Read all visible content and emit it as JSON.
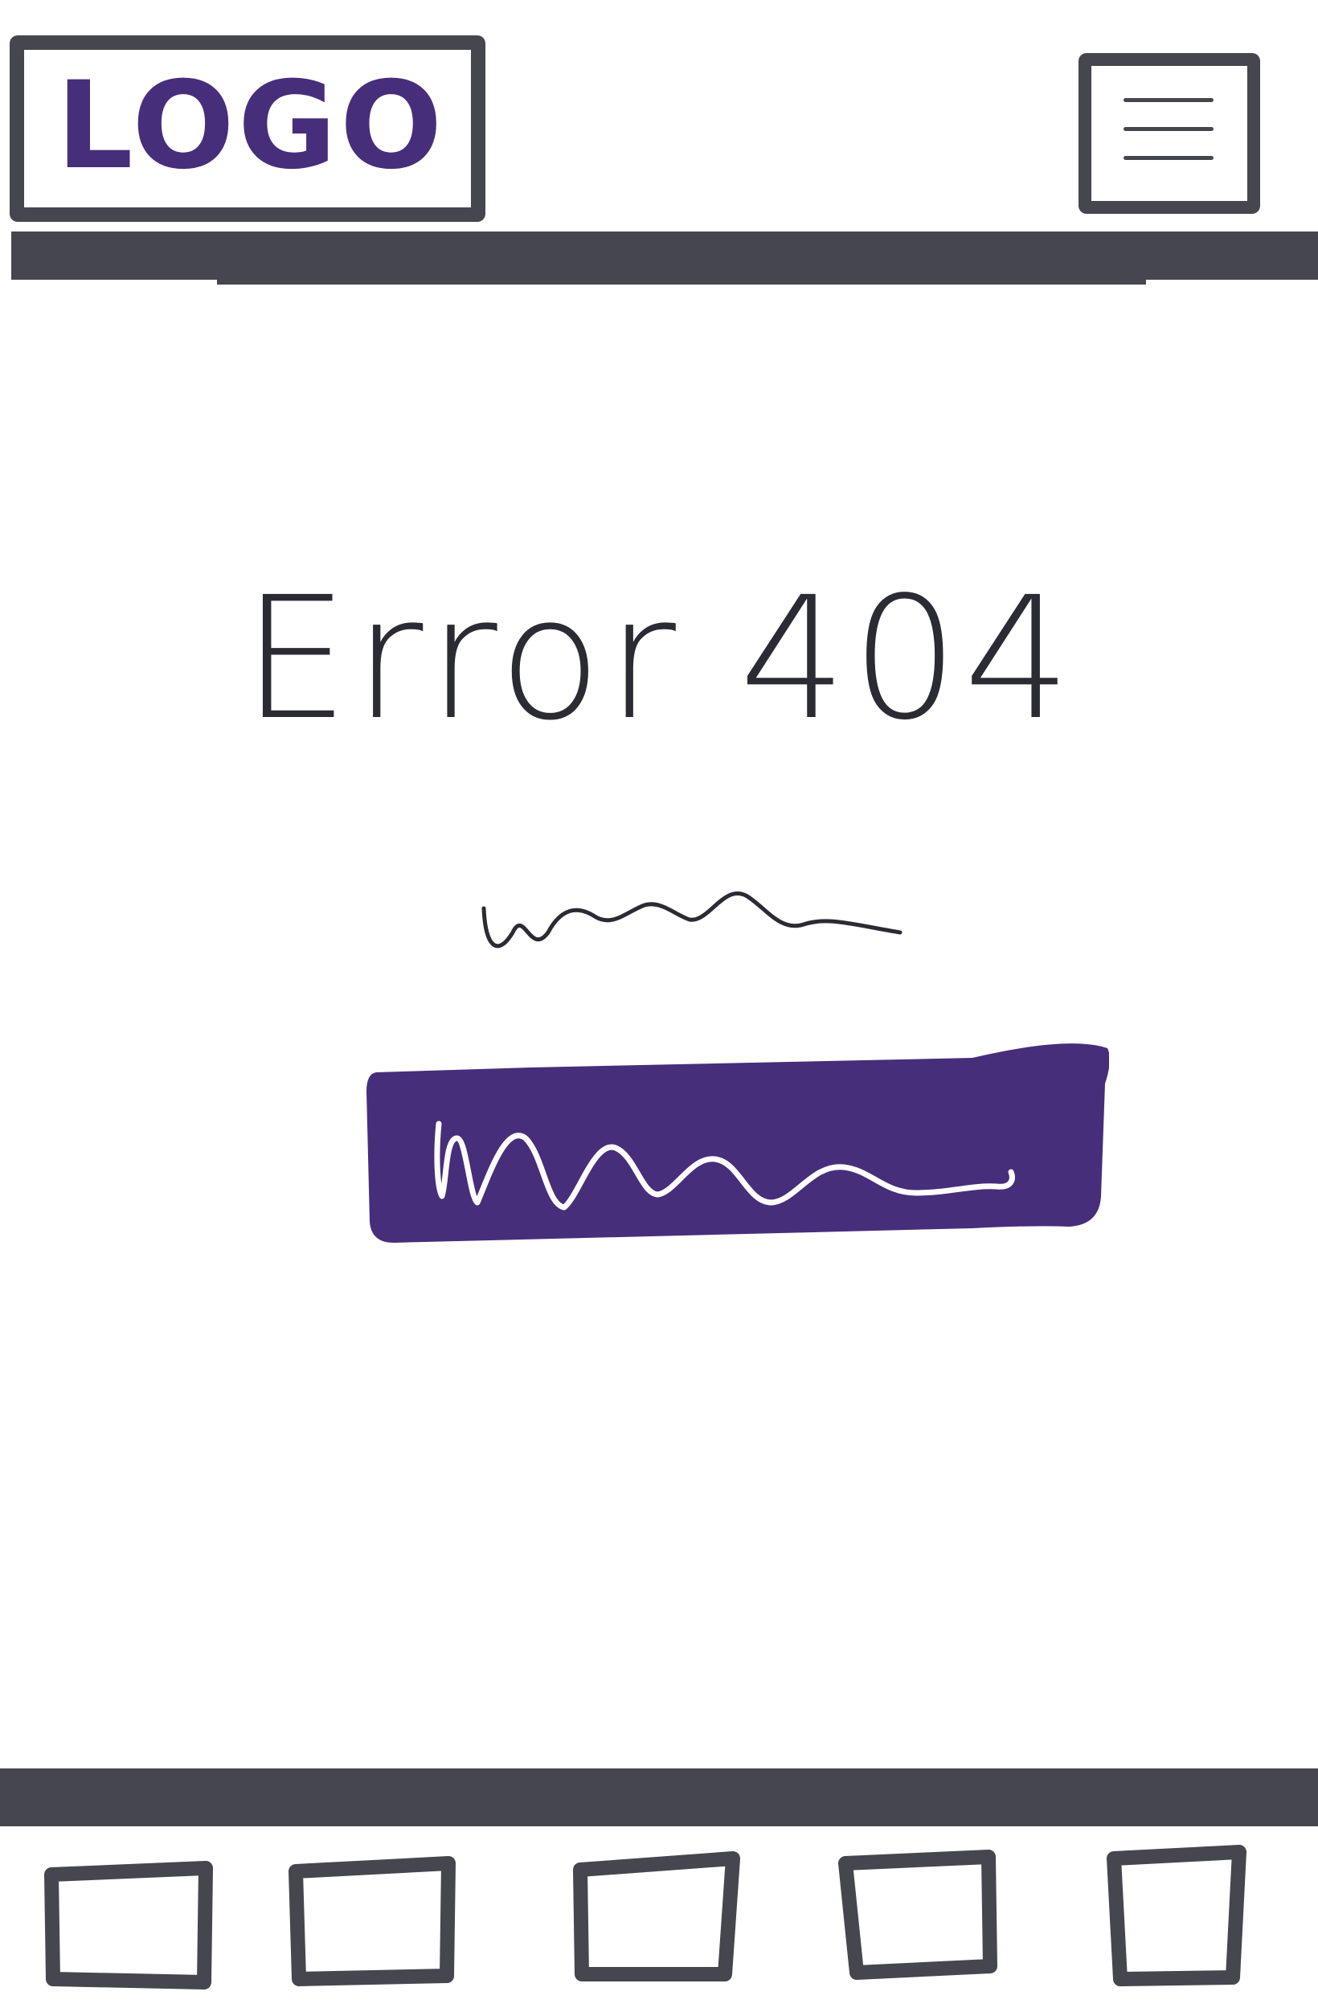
{
  "header": {
    "logo_text": "LOGO",
    "menu_icon": "hamburger-menu-icon"
  },
  "main": {
    "title": "Error 404",
    "description_placeholder": "squiggle",
    "cta_label_placeholder": "squiggle"
  },
  "footer": {
    "items": [
      {
        "icon": "box-icon"
      },
      {
        "icon": "box-icon"
      },
      {
        "icon": "box-icon"
      },
      {
        "icon": "box-icon"
      },
      {
        "icon": "box-icon"
      }
    ]
  },
  "colors": {
    "accent": "#472e7a",
    "stroke": "#46464e",
    "background": "#ffffff",
    "button_text": "#ffffff"
  }
}
